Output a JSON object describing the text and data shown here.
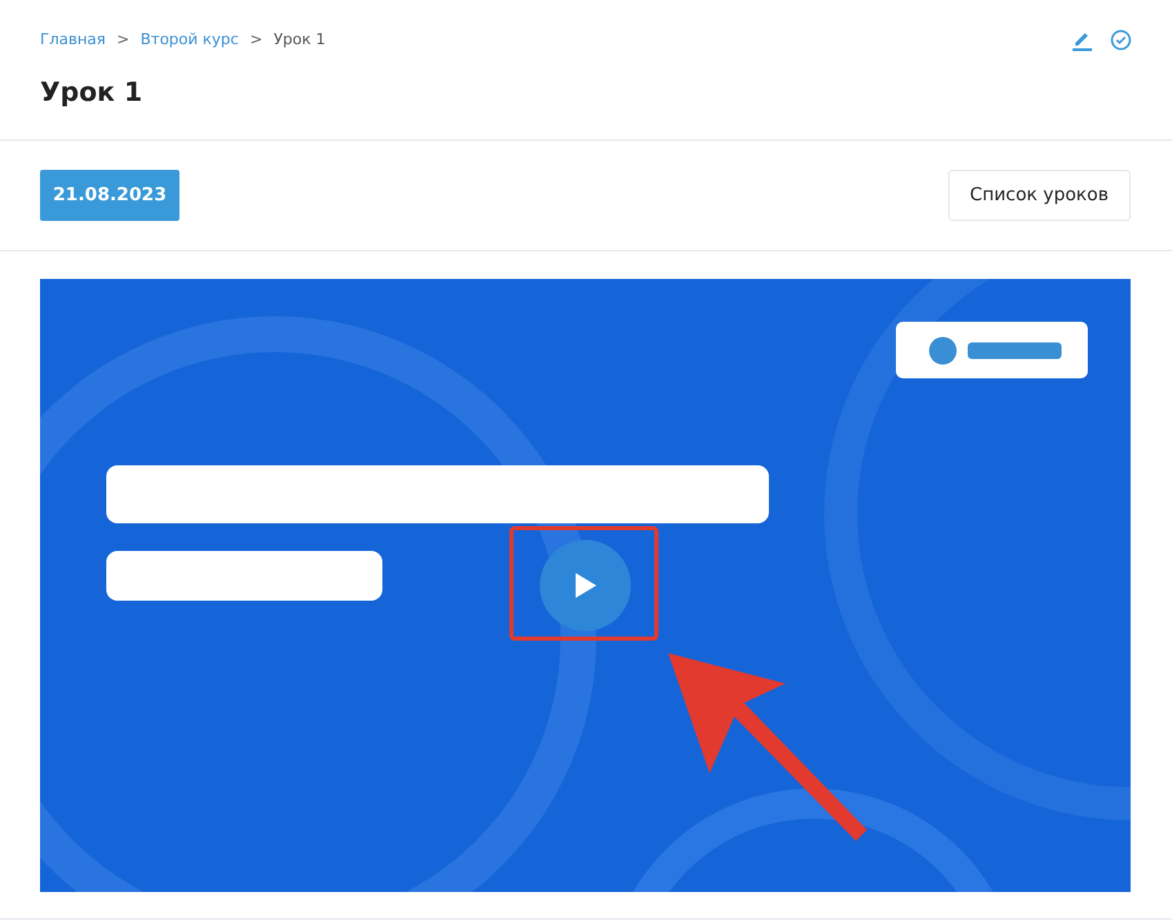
{
  "breadcrumb": [
    {
      "label": "Главная",
      "kind": "link"
    },
    {
      "label": ">",
      "kind": "separator"
    },
    {
      "label": "Второй курс",
      "kind": "link"
    },
    {
      "label": ">",
      "kind": "separator"
    },
    {
      "label": "Урок 1",
      "kind": "current"
    }
  ],
  "title": "Урок 1",
  "date_button": "21.08.2023",
  "lessons_button": "Список уроков"
}
